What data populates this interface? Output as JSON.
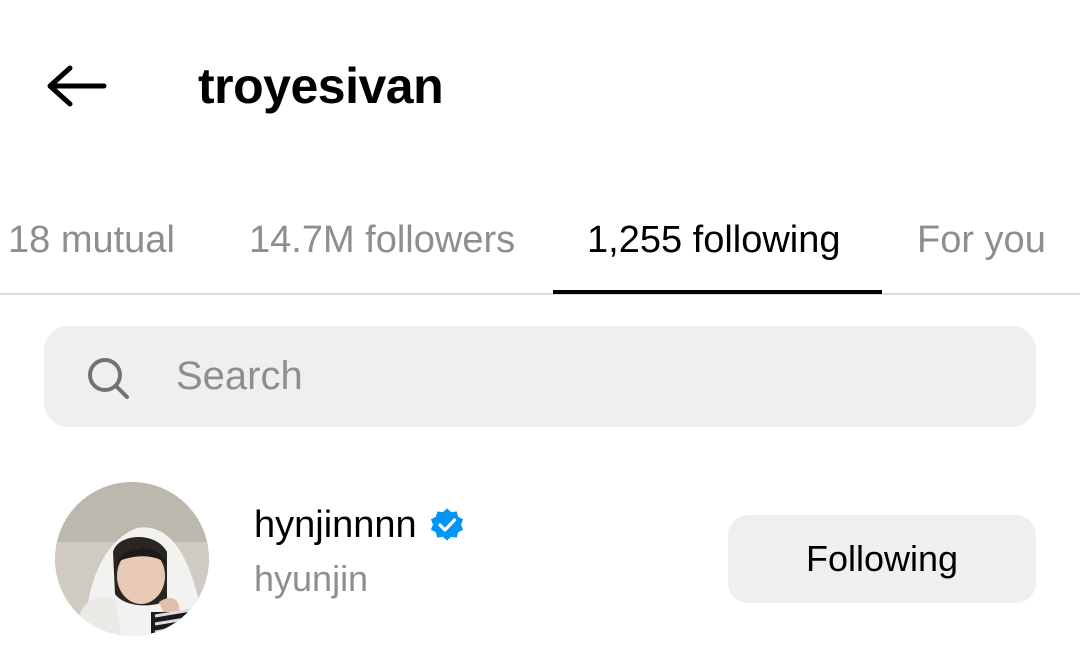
{
  "header": {
    "back_icon": "arrow-left-icon",
    "title": "troyesivan"
  },
  "tabs": [
    {
      "label": "18 mutual",
      "active": false
    },
    {
      "label": "14.7M followers",
      "active": false
    },
    {
      "label": "1,255 following",
      "active": true
    },
    {
      "label": "For you",
      "active": false
    }
  ],
  "search": {
    "icon": "search-icon",
    "placeholder": "Search",
    "value": ""
  },
  "users": [
    {
      "username": "hynjinnnn",
      "verified": true,
      "full_name": "hyunjin",
      "button_label": "Following"
    }
  ],
  "colors": {
    "text_primary": "#000000",
    "text_secondary": "#8e8e8e",
    "control_bg": "#efefef",
    "divider": "#dbdbdb",
    "verified_blue": "#0095f6"
  }
}
